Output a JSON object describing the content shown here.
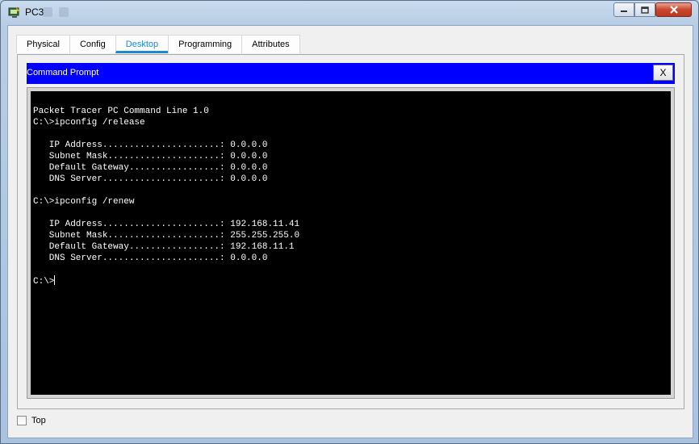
{
  "window": {
    "title": "PC3",
    "icons": {
      "app": "pc-monitor-icon",
      "minimize": "minimize-icon",
      "maximize": "maximize-icon",
      "close": "close-icon"
    }
  },
  "tabs": [
    {
      "label": "Physical",
      "active": false
    },
    {
      "label": "Config",
      "active": false
    },
    {
      "label": "Desktop",
      "active": true
    },
    {
      "label": "Programming",
      "active": false
    },
    {
      "label": "Attributes",
      "active": false
    }
  ],
  "command_prompt": {
    "title": "Command Prompt",
    "close_label": "X",
    "lines": [
      "Packet Tracer PC Command Line 1.0",
      "C:\\>ipconfig /release",
      "",
      "   IP Address......................: 0.0.0.0",
      "   Subnet Mask.....................: 0.0.0.0",
      "   Default Gateway.................: 0.0.0.0",
      "   DNS Server......................: 0.0.0.0",
      "",
      "C:\\>ipconfig /renew",
      "",
      "   IP Address......................: 192.168.11.41",
      "   Subnet Mask.....................: 255.255.255.0",
      "   Default Gateway.................: 192.168.11.1",
      "   DNS Server......................: 0.0.0.0",
      ""
    ],
    "prompt": "C:\\>"
  },
  "footer": {
    "top_label": "Top",
    "top_checked": false
  },
  "colors": {
    "cmd_header": "#0000ff",
    "active_tab": "#1b8ad3",
    "terminal_bg": "#000000",
    "terminal_fg": "#ffffff"
  }
}
